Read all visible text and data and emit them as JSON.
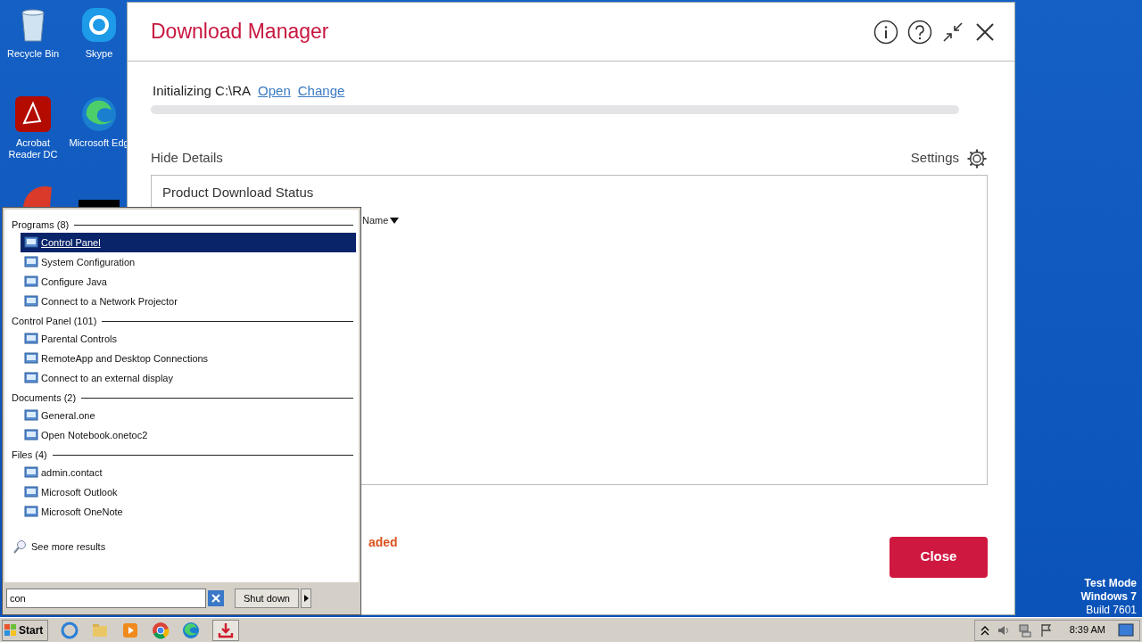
{
  "desktop_icons": [
    {
      "label": "Recycle Bin",
      "kind": "bin"
    },
    {
      "label": "Skype",
      "kind": "skype"
    },
    {
      "label": "Acrobat Reader DC",
      "kind": "acrobat"
    },
    {
      "label": "Microsoft Edg",
      "kind": "edge"
    }
  ],
  "window": {
    "title": "Download Manager",
    "status_text": "Initializing",
    "path": "C:\\RA",
    "links": [
      "Open",
      "Change"
    ],
    "progress": {
      "level": 0
    },
    "details_toggle": "Hide Details",
    "settings_label": "Settings",
    "panel": {
      "title": "Product Download Status",
      "sort_value": "Name"
    },
    "status_message": "aded",
    "close_button": "Close"
  },
  "start_menu": {
    "groups": [
      {
        "heading": "Programs (8)",
        "items": [
          {
            "label": "Control Panel",
            "selected": true
          },
          {
            "label": "System Configuration",
            "selected": false
          },
          {
            "label": "Configure Java",
            "selected": false
          },
          {
            "label": "Connect to a Network Projector",
            "selected": false
          }
        ]
      },
      {
        "heading": "Control Panel (101)",
        "items": [
          {
            "label": "Parental Controls",
            "selected": false
          },
          {
            "label": "RemoteApp and Desktop Connections",
            "selected": false
          },
          {
            "label": "Connect to an external display",
            "selected": false
          }
        ]
      },
      {
        "heading": "Documents (2)",
        "items": [
          {
            "label": "General.one",
            "selected": false
          },
          {
            "label": "Open Notebook.onetoc2",
            "selected": false
          }
        ]
      },
      {
        "heading": "Files (4)",
        "items": [
          {
            "label": "admin.contact",
            "selected": false
          },
          {
            "label": "Microsoft Outlook",
            "selected": false
          },
          {
            "label": "Microsoft OneNote",
            "selected": false
          }
        ]
      }
    ],
    "see_more": "See more results",
    "search": {
      "value": "con"
    },
    "shutdown": "Shut down"
  },
  "taskbar": {
    "start": "Start",
    "clock": "8:39 AM"
  },
  "system_notice": [
    "Test Mode",
    "Windows 7",
    "Build 7601"
  ]
}
